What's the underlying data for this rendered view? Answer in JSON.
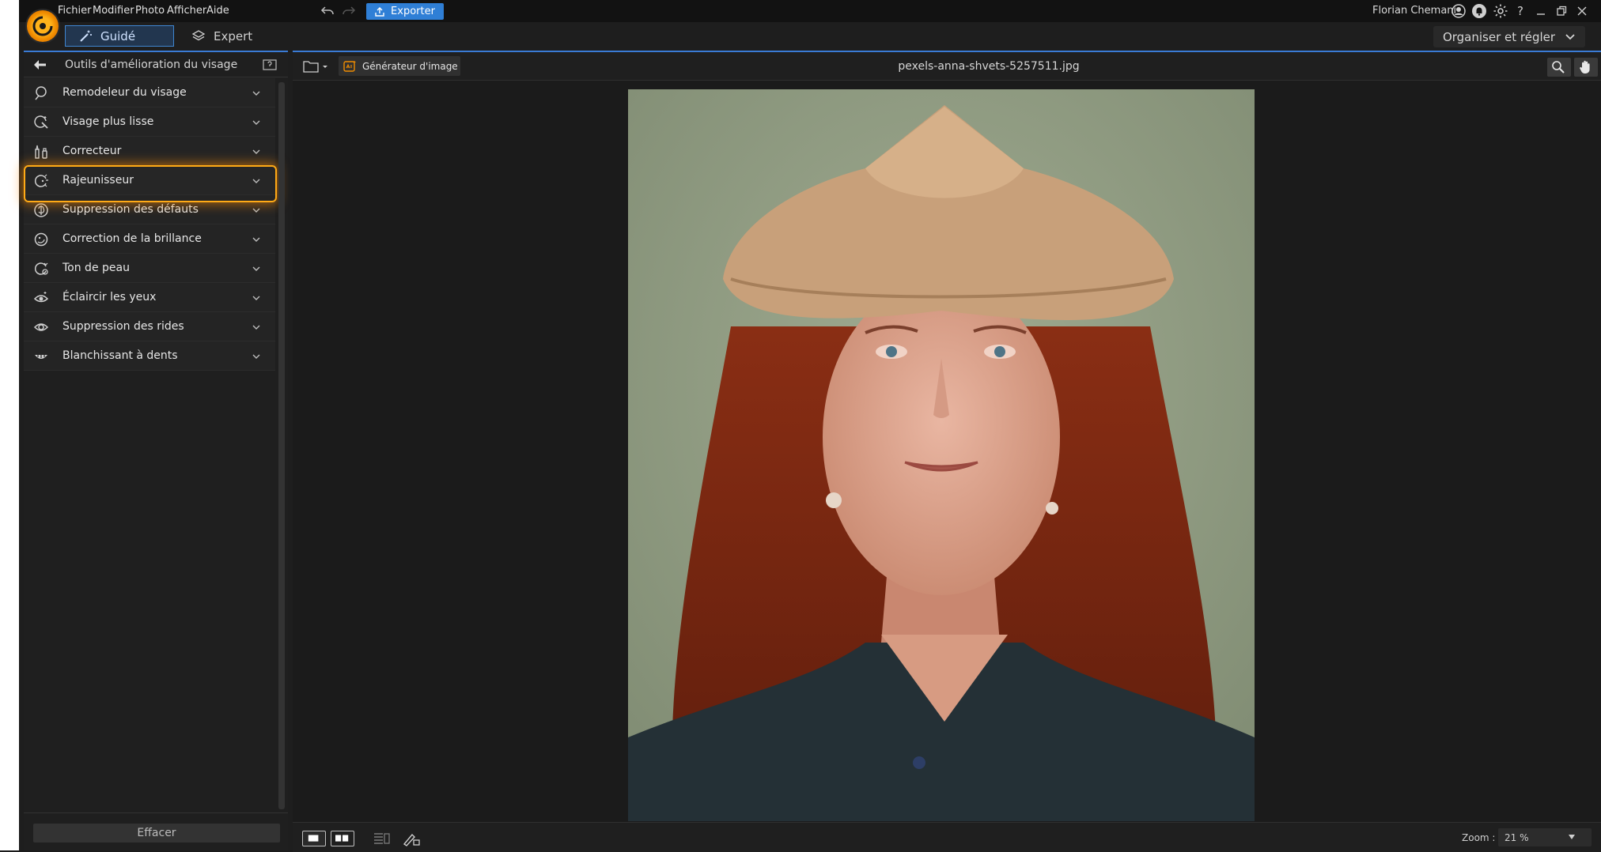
{
  "menu": [
    "Fichier",
    "Modifier",
    "Photo",
    "Afficher",
    "Aide"
  ],
  "toolbar": {
    "export_label": "Exporter"
  },
  "user": {
    "name": "Florian Chemani"
  },
  "modes": {
    "guided": "Guidé",
    "expert": "Expert",
    "organize": "Organiser et régler"
  },
  "panel": {
    "title": "Outils d'amélioration du visage",
    "tools": [
      {
        "label": "Remodeleur du visage",
        "icon": "face-reshape-icon"
      },
      {
        "label": "Visage plus lisse",
        "icon": "face-smooth-icon"
      },
      {
        "label": "Correcteur",
        "icon": "corrector-icon"
      },
      {
        "label": "Rajeunisseur",
        "icon": "rejuvenate-icon",
        "highlighted": true
      },
      {
        "label": "Suppression des défauts",
        "icon": "blemish-removal-icon"
      },
      {
        "label": "Correction de la brillance",
        "icon": "shine-removal-icon"
      },
      {
        "label": "Ton de peau",
        "icon": "skin-tone-icon"
      },
      {
        "label": "Éclaircir les yeux",
        "icon": "eye-brighten-icon"
      },
      {
        "label": "Suppression des rides",
        "icon": "wrinkle-removal-icon"
      },
      {
        "label": "Blanchissant à dents",
        "icon": "teeth-whitening-icon"
      }
    ],
    "clear_label": "Effacer"
  },
  "main": {
    "generator_label": "Générateur d'image",
    "file_name": "pexels-anna-shvets-5257511.jpg",
    "zoom_label": "Zoom :",
    "zoom_value": "21 %"
  },
  "colors": {
    "accent": "#3a7bd5",
    "export": "#2f7fd6",
    "highlight": "#ffaa16"
  }
}
